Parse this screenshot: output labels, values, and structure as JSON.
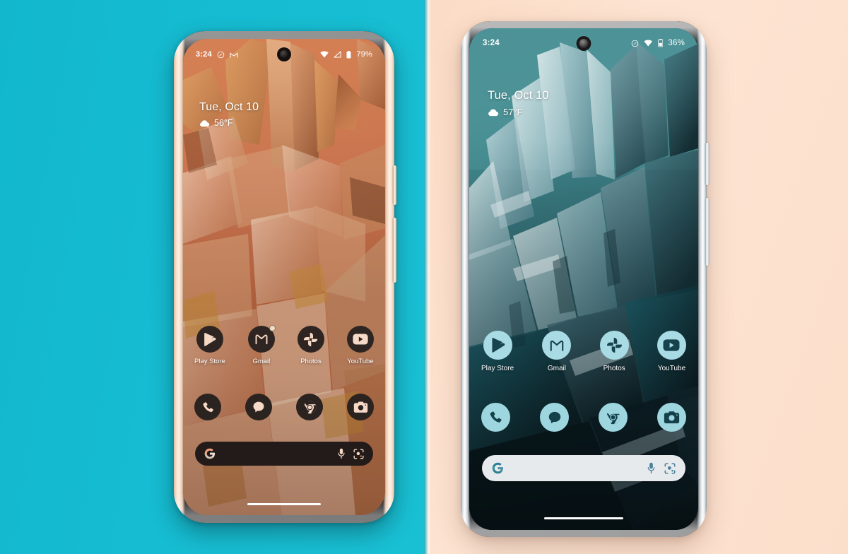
{
  "scene": {
    "description": "Two Android smartphones side by side on a split cyan and peach background",
    "background_left_color": "#17bad0",
    "background_right_color": "#fce2ce"
  },
  "phones": [
    {
      "id": "left",
      "name": "smaller-phone",
      "frame_color": "#f3d6bf",
      "frame_name": "champagne-rose-gold",
      "wallpaper": "amber-crystal-macro",
      "accent_color": "#2e2522",
      "icon_glyph_color": "#f6d9c6",
      "status_bar": {
        "time": "3:24",
        "icons_left": [
          "do-not-disturb-icon",
          "gmail-icon"
        ],
        "icons_right": [
          "wifi-icon",
          "signal-icon",
          "battery-icon"
        ],
        "battery": "79%"
      },
      "clock_widget": {
        "date": "Tue, Oct 10",
        "weather_icon": "cloud-icon",
        "temperature": "56°F"
      },
      "apps": [
        {
          "label": "Play Store",
          "icon": "play-store-icon",
          "badge": true
        },
        {
          "label": "Gmail",
          "icon": "gmail-icon",
          "badge": true
        },
        {
          "label": "Photos",
          "icon": "google-photos-icon",
          "badge": false
        },
        {
          "label": "YouTube",
          "icon": "youtube-icon",
          "badge": false
        }
      ],
      "dock": [
        {
          "label": "Phone",
          "icon": "phone-icon"
        },
        {
          "label": "Messages",
          "icon": "messages-icon"
        },
        {
          "label": "Chrome",
          "icon": "chrome-icon"
        },
        {
          "label": "Camera",
          "icon": "camera-icon"
        }
      ],
      "search": {
        "logo": "google-g-icon",
        "placeholder": "",
        "value": "",
        "mic": "microphone-icon",
        "lens": "google-lens-icon",
        "bar_color": "#221b19"
      },
      "nav": {
        "gesture_pill": "home-gesture-pill"
      }
    },
    {
      "id": "right",
      "name": "larger-phone",
      "frame_color": "#cfd8de",
      "frame_name": "polished-silver",
      "wallpaper": "teal-ice-crystal-macro",
      "accent_color": "#a8dbe4",
      "icon_glyph_color": "#15414c",
      "status_bar": {
        "time": "3:24",
        "icons_left": [],
        "icons_right": [
          "do-not-disturb-icon",
          "wifi-icon",
          "battery-icon"
        ],
        "battery": "36%"
      },
      "clock_widget": {
        "date": "Tue, Oct 10",
        "weather_icon": "cloud-icon",
        "temperature": "57°F"
      },
      "apps": [
        {
          "label": "Play Store",
          "icon": "play-store-icon",
          "badge": false
        },
        {
          "label": "Gmail",
          "icon": "gmail-icon",
          "badge": false
        },
        {
          "label": "Photos",
          "icon": "google-photos-icon",
          "badge": false
        },
        {
          "label": "YouTube",
          "icon": "youtube-icon",
          "badge": false
        }
      ],
      "dock": [
        {
          "label": "Phone",
          "icon": "phone-icon"
        },
        {
          "label": "Messages",
          "icon": "messages-icon"
        },
        {
          "label": "Chrome",
          "icon": "chrome-icon"
        },
        {
          "label": "Camera",
          "icon": "camera-icon"
        }
      ],
      "search": {
        "logo": "google-g-icon",
        "placeholder": "",
        "value": "",
        "mic": "microphone-icon",
        "lens": "google-lens-icon",
        "bar_color": "#e6eaec"
      },
      "nav": {
        "gesture_pill": "home-gesture-pill"
      }
    }
  ]
}
